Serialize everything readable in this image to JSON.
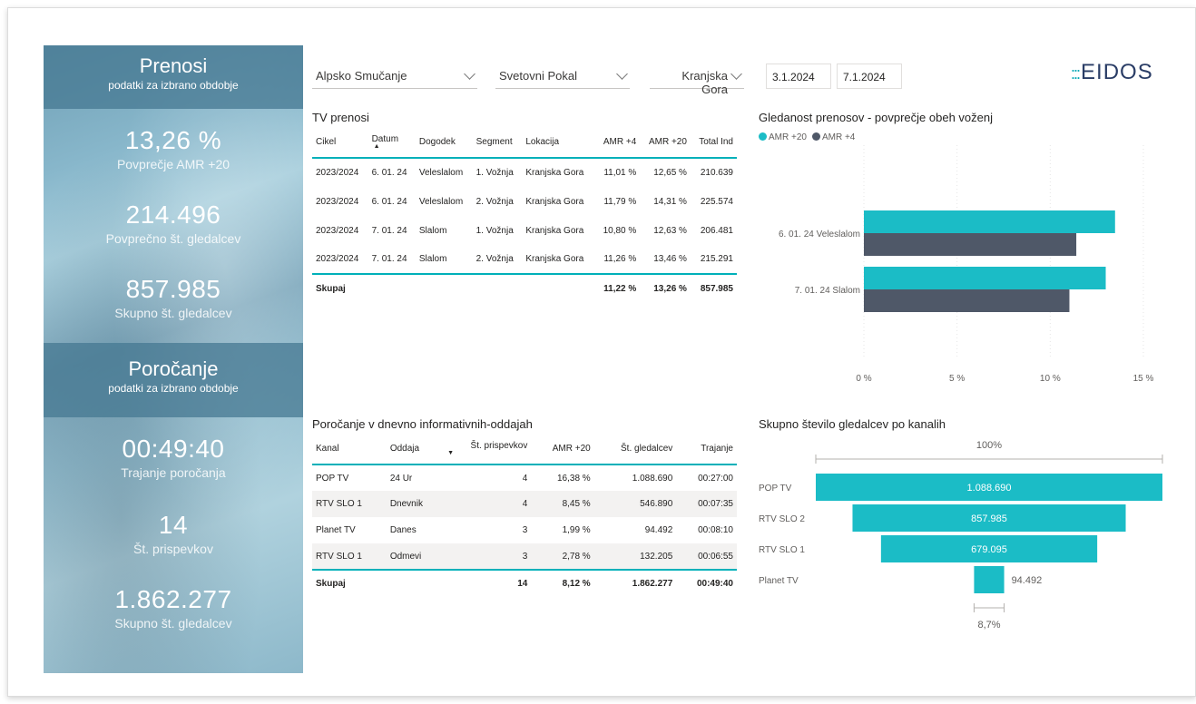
{
  "left_panel": {
    "prenosi_title": "Prenosi",
    "prenosi_subtitle": "podatki za izbrano obdobje",
    "kpi_amr20_value": "13,26 %",
    "kpi_amr20_label": "Povprečje AMR +20",
    "kpi_avg_viewers_value": "214.496",
    "kpi_avg_viewers_label": "Povprečno št. gledalcev",
    "kpi_total_viewers_value": "857.985",
    "kpi_total_viewers_label": "Skupno št. gledalcev",
    "porocanje_title": "Poročanje",
    "porocanje_subtitle": "podatki za izbrano obdobje",
    "kpi_duration_value": "00:49:40",
    "kpi_duration_label": "Trajanje poročanja",
    "kpi_count_value": "14",
    "kpi_count_label": "Št. prispevkov",
    "kpi_report_viewers_value": "1.862.277",
    "kpi_report_viewers_label": "Skupno št. gledalcev"
  },
  "filters": {
    "discipline": "Alpsko Smučanje",
    "competition": "Svetovni Pokal",
    "location": "Kranjska Gora",
    "date_from": "3.1.2024",
    "date_to": "7.1.2024"
  },
  "logo": {
    "dots": ":::",
    "text": "EIDOS"
  },
  "tv_table": {
    "title": "TV prenosi",
    "columns": [
      "Cikel",
      "Datum",
      "Dogodek",
      "Segment",
      "Lokacija",
      "AMR +4",
      "AMR +20",
      "Total Ind"
    ],
    "rows": [
      [
        "2023/2024",
        "6. 01. 24",
        "Veleslalom",
        "1. Vožnja",
        "Kranjska Gora",
        "11,01 %",
        "12,65 %",
        "210.639"
      ],
      [
        "2023/2024",
        "6. 01. 24",
        "Veleslalom",
        "2. Vožnja",
        "Kranjska Gora",
        "11,79 %",
        "14,31 %",
        "225.574"
      ],
      [
        "2023/2024",
        "7. 01. 24",
        "Slalom",
        "1. Vožnja",
        "Kranjska Gora",
        "10,80 %",
        "12,63 %",
        "206.481"
      ],
      [
        "2023/2024",
        "7. 01. 24",
        "Slalom",
        "2. Vožnja",
        "Kranjska Gora",
        "11,26 %",
        "13,46 %",
        "215.291"
      ]
    ],
    "total": {
      "label": "Skupaj",
      "amr4": "11,22 %",
      "amr20": "13,26 %",
      "total_ind": "857.985"
    }
  },
  "report_table": {
    "title": "Poročanje v dnevno informativnih-oddajah",
    "columns": [
      "Kanal",
      "Oddaja",
      "Št. prispevkov",
      "AMR +20",
      "Št. gledalcev",
      "Trajanje"
    ],
    "rows": [
      [
        "POP TV",
        "24 Ur",
        "4",
        "16,38 %",
        "1.088.690",
        "00:27:00"
      ],
      [
        "RTV SLO 1",
        "Dnevnik",
        "4",
        "8,45 %",
        "546.890",
        "00:07:35"
      ],
      [
        "Planet TV",
        "Danes",
        "3",
        "1,99 %",
        "94.492",
        "00:08:10"
      ],
      [
        "RTV SLO 1",
        "Odmevi",
        "3",
        "2,78 %",
        "132.205",
        "00:06:55"
      ]
    ],
    "total": {
      "label": "Skupaj",
      "count": "14",
      "amr20": "8,12 %",
      "viewers": "1.862.277",
      "duration": "00:49:40"
    }
  },
  "colors": {
    "teal": "#1bbcc6",
    "slate": "#4f5868",
    "header_teal": "#00b0b9"
  },
  "chart_data": [
    {
      "type": "bar",
      "orientation": "horizontal",
      "title": "Gledanost prenosov - povprečje obeh voženj",
      "categories": [
        "6. 01. 24 Veleslalom",
        "7. 01. 24 Slalom"
      ],
      "series": [
        {
          "name": "AMR +20",
          "values": [
            13.48,
            12.98
          ]
        },
        {
          "name": "AMR +4",
          "values": [
            11.4,
            11.03
          ]
        }
      ],
      "xlim": [
        0,
        15
      ],
      "x_ticks": [
        "0 %",
        "5 %",
        "10 %",
        "15 %"
      ],
      "legend": "top-left",
      "grid": true
    },
    {
      "type": "funnel",
      "title": "Skupno število gledalcev po kanalih",
      "categories": [
        "POP TV",
        "RTV SLO 2",
        "RTV SLO 1",
        "Planet TV"
      ],
      "values": [
        1088690,
        857985,
        679095,
        94492
      ],
      "value_labels": [
        "1.088.690",
        "857.985",
        "679.095",
        "94.492"
      ],
      "top_label": "100%",
      "bottom_label": "8,7%"
    }
  ]
}
